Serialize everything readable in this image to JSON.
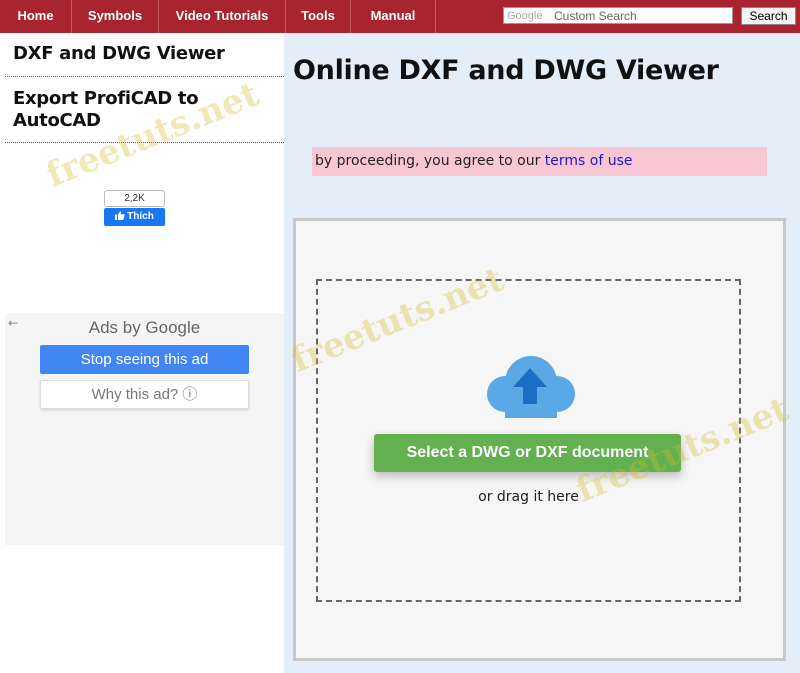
{
  "nav": {
    "items": [
      {
        "label": "Home"
      },
      {
        "label": "Symbols"
      },
      {
        "label": "Video Tutorials"
      },
      {
        "label": "Tools"
      },
      {
        "label": "Manual"
      }
    ]
  },
  "search": {
    "google_label": "Google",
    "placeholder": "Custom Search",
    "button_label": "Search"
  },
  "sidebar": {
    "links": [
      {
        "label": "DXF and DWG Viewer"
      },
      {
        "label": "Export ProfiCAD to AutoCAD"
      }
    ],
    "fb_like": {
      "count": "2,2K",
      "label": "Thích"
    }
  },
  "ad": {
    "title": "Ads by Google",
    "stop_label": "Stop seeing this ad",
    "why_label": "Why this ad? ⓘ"
  },
  "main": {
    "title": "Online DXF and DWG Viewer",
    "notice_text": "by proceeding, you agree to our ",
    "notice_link": "terms of use",
    "upload_button": "Select a DWG or DXF document",
    "drag_text": "or drag it here"
  },
  "watermark": "freetuts.net",
  "colors": {
    "nav_bg": "#a82530",
    "upload_button": "#62b04f",
    "cloud": "#5aa9e6",
    "notice_bg": "#f9c7d3",
    "main_bg": "#e4eef8",
    "ad_button": "#4285f4"
  }
}
